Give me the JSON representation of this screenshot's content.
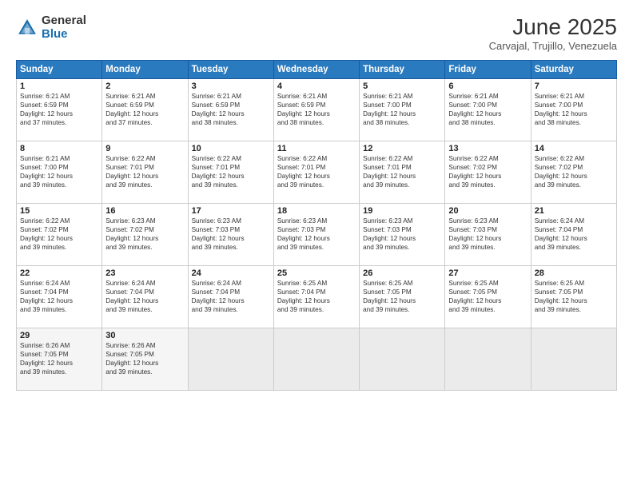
{
  "logo": {
    "general": "General",
    "blue": "Blue"
  },
  "header": {
    "month_year": "June 2025",
    "location": "Carvajal, Trujillo, Venezuela"
  },
  "days_of_week": [
    "Sunday",
    "Monday",
    "Tuesday",
    "Wednesday",
    "Thursday",
    "Friday",
    "Saturday"
  ],
  "weeks": [
    [
      {
        "day": 1,
        "info": "Sunrise: 6:21 AM\nSunset: 6:59 PM\nDaylight: 12 hours\nand 37 minutes."
      },
      {
        "day": 2,
        "info": "Sunrise: 6:21 AM\nSunset: 6:59 PM\nDaylight: 12 hours\nand 37 minutes."
      },
      {
        "day": 3,
        "info": "Sunrise: 6:21 AM\nSunset: 6:59 PM\nDaylight: 12 hours\nand 38 minutes."
      },
      {
        "day": 4,
        "info": "Sunrise: 6:21 AM\nSunset: 6:59 PM\nDaylight: 12 hours\nand 38 minutes."
      },
      {
        "day": 5,
        "info": "Sunrise: 6:21 AM\nSunset: 7:00 PM\nDaylight: 12 hours\nand 38 minutes."
      },
      {
        "day": 6,
        "info": "Sunrise: 6:21 AM\nSunset: 7:00 PM\nDaylight: 12 hours\nand 38 minutes."
      },
      {
        "day": 7,
        "info": "Sunrise: 6:21 AM\nSunset: 7:00 PM\nDaylight: 12 hours\nand 38 minutes."
      }
    ],
    [
      {
        "day": 8,
        "info": "Sunrise: 6:21 AM\nSunset: 7:00 PM\nDaylight: 12 hours\nand 39 minutes."
      },
      {
        "day": 9,
        "info": "Sunrise: 6:22 AM\nSunset: 7:01 PM\nDaylight: 12 hours\nand 39 minutes."
      },
      {
        "day": 10,
        "info": "Sunrise: 6:22 AM\nSunset: 7:01 PM\nDaylight: 12 hours\nand 39 minutes."
      },
      {
        "day": 11,
        "info": "Sunrise: 6:22 AM\nSunset: 7:01 PM\nDaylight: 12 hours\nand 39 minutes."
      },
      {
        "day": 12,
        "info": "Sunrise: 6:22 AM\nSunset: 7:01 PM\nDaylight: 12 hours\nand 39 minutes."
      },
      {
        "day": 13,
        "info": "Sunrise: 6:22 AM\nSunset: 7:02 PM\nDaylight: 12 hours\nand 39 minutes."
      },
      {
        "day": 14,
        "info": "Sunrise: 6:22 AM\nSunset: 7:02 PM\nDaylight: 12 hours\nand 39 minutes."
      }
    ],
    [
      {
        "day": 15,
        "info": "Sunrise: 6:22 AM\nSunset: 7:02 PM\nDaylight: 12 hours\nand 39 minutes."
      },
      {
        "day": 16,
        "info": "Sunrise: 6:23 AM\nSunset: 7:02 PM\nDaylight: 12 hours\nand 39 minutes."
      },
      {
        "day": 17,
        "info": "Sunrise: 6:23 AM\nSunset: 7:03 PM\nDaylight: 12 hours\nand 39 minutes."
      },
      {
        "day": 18,
        "info": "Sunrise: 6:23 AM\nSunset: 7:03 PM\nDaylight: 12 hours\nand 39 minutes."
      },
      {
        "day": 19,
        "info": "Sunrise: 6:23 AM\nSunset: 7:03 PM\nDaylight: 12 hours\nand 39 minutes."
      },
      {
        "day": 20,
        "info": "Sunrise: 6:23 AM\nSunset: 7:03 PM\nDaylight: 12 hours\nand 39 minutes."
      },
      {
        "day": 21,
        "info": "Sunrise: 6:24 AM\nSunset: 7:04 PM\nDaylight: 12 hours\nand 39 minutes."
      }
    ],
    [
      {
        "day": 22,
        "info": "Sunrise: 6:24 AM\nSunset: 7:04 PM\nDaylight: 12 hours\nand 39 minutes."
      },
      {
        "day": 23,
        "info": "Sunrise: 6:24 AM\nSunset: 7:04 PM\nDaylight: 12 hours\nand 39 minutes."
      },
      {
        "day": 24,
        "info": "Sunrise: 6:24 AM\nSunset: 7:04 PM\nDaylight: 12 hours\nand 39 minutes."
      },
      {
        "day": 25,
        "info": "Sunrise: 6:25 AM\nSunset: 7:04 PM\nDaylight: 12 hours\nand 39 minutes."
      },
      {
        "day": 26,
        "info": "Sunrise: 6:25 AM\nSunset: 7:05 PM\nDaylight: 12 hours\nand 39 minutes."
      },
      {
        "day": 27,
        "info": "Sunrise: 6:25 AM\nSunset: 7:05 PM\nDaylight: 12 hours\nand 39 minutes."
      },
      {
        "day": 28,
        "info": "Sunrise: 6:25 AM\nSunset: 7:05 PM\nDaylight: 12 hours\nand 39 minutes."
      }
    ],
    [
      {
        "day": 29,
        "info": "Sunrise: 6:26 AM\nSunset: 7:05 PM\nDaylight: 12 hours\nand 39 minutes."
      },
      {
        "day": 30,
        "info": "Sunrise: 6:26 AM\nSunset: 7:05 PM\nDaylight: 12 hours\nand 39 minutes."
      },
      null,
      null,
      null,
      null,
      null
    ]
  ]
}
